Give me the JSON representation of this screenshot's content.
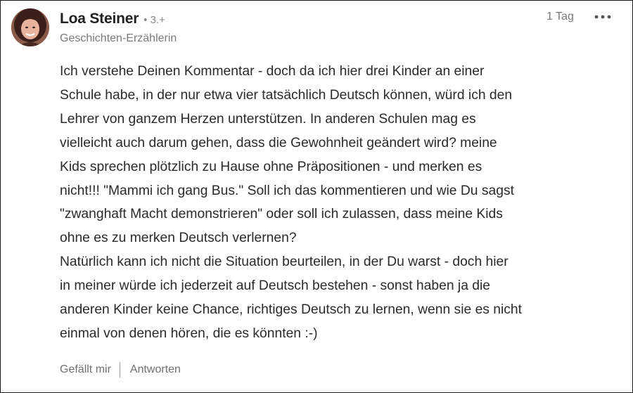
{
  "comment": {
    "author": {
      "name": "Loa Steiner",
      "degree": "• 3.+",
      "headline": "Geschichten-Erzählerin",
      "avatar_icon": "profile-photo"
    },
    "time": "1 Tag",
    "more_icon": "more-horizontal-icon",
    "paragraphs": [
      "Ich verstehe Deinen Kommentar - doch da ich hier drei Kinder an einer\nSchule habe, in der nur etwa vier tatsächlich Deutsch können, würd ich den\nLehrer von ganzem Herzen unterstützen. In anderen Schulen mag es\nvielleicht auch darum gehen, dass die Gewohnheit geändert wird? meine\nKids sprechen plötzlich zu Hause ohne Präpositionen - und merken es\nnicht!!! \"Mammi ich gang Bus.\" Soll ich das kommentieren und wie Du sagst\n\"zwanghaft Macht demonstrieren\" oder soll ich zulassen, dass meine Kids\nohne es zu merken Deutsch verlernen?",
      "Natürlich kann ich nicht die Situation beurteilen, in der Du warst - doch hier\nin meiner würde ich jederzeit auf Deutsch bestehen - sonst haben ja die\nanderen Kinder keine Chance, richtiges Deutsch zu lernen, wenn sie es nicht\neinmal von denen hören, die es könnten :-)"
    ],
    "actions": {
      "like": "Gefällt mir",
      "reply": "Antworten"
    }
  }
}
